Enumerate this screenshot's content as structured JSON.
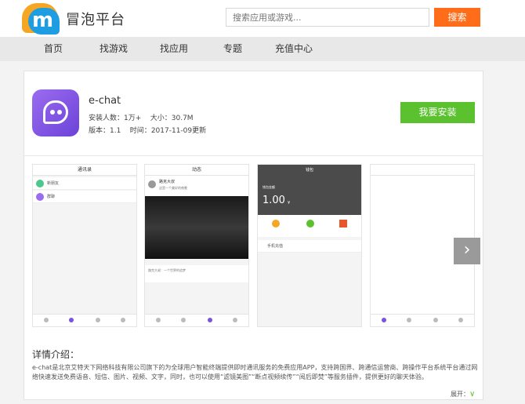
{
  "header": {
    "brand": "冒泡平台",
    "logo_letter": "m",
    "search_placeholder": "搜索应用或游戏...",
    "search_button": "搜索"
  },
  "nav": {
    "items": [
      "首页",
      "找游戏",
      "找应用",
      "专题",
      "充值中心"
    ]
  },
  "app": {
    "name": "e-chat",
    "installs_label": "安装人数：",
    "installs": "1万+",
    "size_label": "大小：",
    "size": "30.7M",
    "version_label": "版本：",
    "version": "1.1",
    "time_label": "时间：",
    "date": "2017-11-09更新",
    "install_button": "我要安装"
  },
  "screenshots": {
    "s1_title": "通讯录",
    "s1_row1": "新朋友",
    "s1_row2": "群聊",
    "s2_title": "动态",
    "s2_user": "路克大叔",
    "s2_post": "这是一个美好的夜晚",
    "s2_comment": "路克大叔：一个世界的追梦",
    "s3_title": "钱包",
    "s3_label": "钱包金额",
    "s3_amount": "1.00",
    "s3_currency": "¥",
    "s3_row": "手机充值",
    "next_arrow": "›"
  },
  "details": {
    "title": "详情介绍：",
    "description": "e-chat是北京艾特天下网络科技有限公司旗下的为全球用户智能终端提供即时通讯服务的免费应用APP，支持跨国界、跨通信运营商、跨操作平台系统平台通过网络快速发送免费语音、短信、图片、视频、文字，同时，也可以使用“滤镜美图”“断点视频续传”“阅后即焚”等服务插件，提供更好的聊天体验。",
    "expand_label": "展开："
  },
  "colors": {
    "search_button": "#ff6d1a",
    "install_button": "#5cc12f",
    "logo_blue": "#1e9de3",
    "logo_orange": "#f5a623",
    "app_icon": "#7b52e0"
  },
  "icons": [
    "logo-icon",
    "app-icon",
    "chevron-right-icon",
    "chevron-down-icon"
  ]
}
